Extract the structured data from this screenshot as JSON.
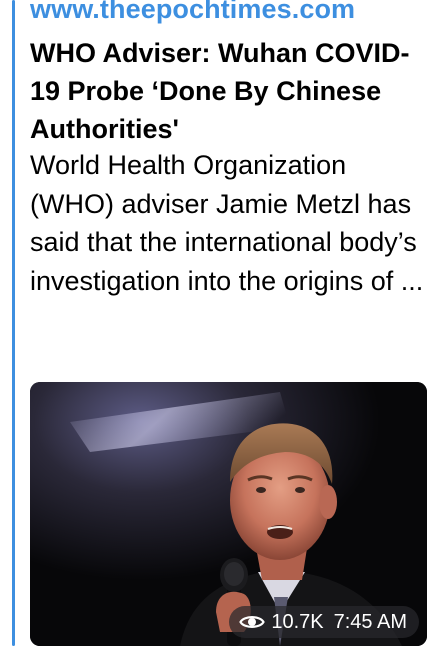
{
  "link_preview": {
    "site": "www.theepochtimes.com",
    "title": "WHO Adviser: Wuhan COVID-19 Probe ‘Done By Chinese Authorities'",
    "description": "World Health Organization (WHO) adviser Jamie Metzl has said that the international body’s investigation into the origins of ...",
    "image_alt": "Man speaking into a microphone on stage"
  },
  "meta": {
    "views": "10.7K",
    "time": "7:45 AM",
    "views_icon": "eye-icon"
  },
  "colors": {
    "accent": "#3d8fe0",
    "text": "#000000",
    "background": "#ffffff"
  }
}
